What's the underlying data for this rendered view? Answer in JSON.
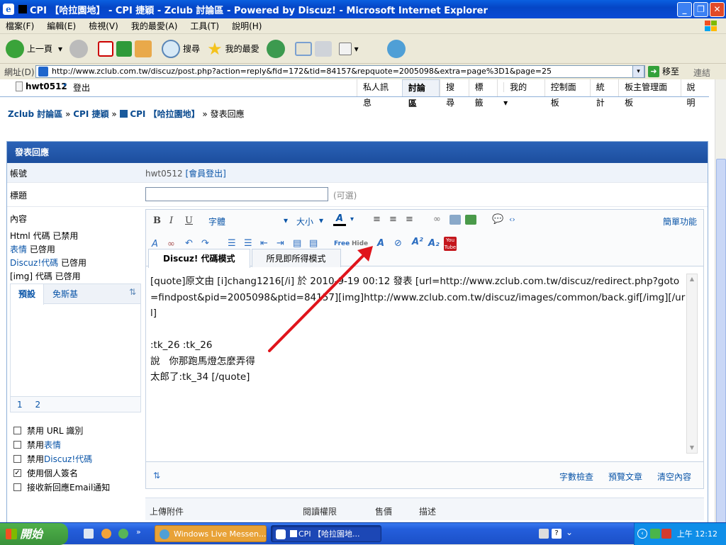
{
  "window": {
    "title": "CPI 【哈拉園地】 - CPI 捷穎 - Zclub 討論區 - Powered by Discuz! - Microsoft Internet Explorer"
  },
  "menu": [
    "檔案(F)",
    "編輯(E)",
    "檢視(V)",
    "我的最愛(A)",
    "工具(T)",
    "說明(H)"
  ],
  "toolbar": {
    "back": "上一頁",
    "search": "搜尋",
    "favorites": "我的最愛"
  },
  "address": {
    "label": "網址(D)",
    "url": "http://www.zclub.com.tw/discuz/post.php?action=reply&fid=172&tid=84157&repquote=2005098&extra=page%3D1&page=25",
    "go": "移至",
    "links": "連結"
  },
  "user": {
    "name": "hwt0512",
    "logout": "登出"
  },
  "topnav": [
    "私人訊息",
    "討論區",
    "搜尋",
    "標籤",
    "我的",
    "控制面板",
    "統計",
    "板主管理面板",
    "說明"
  ],
  "breadcrumb": {
    "home": "Zclub 討論區",
    "sep": "»",
    "forum1": "CPI 捷穎",
    "forum2": "CPI 【哈拉園地】",
    "current": "發表回應"
  },
  "form": {
    "header": "發表回應",
    "account_label": "帳號",
    "account_value": "hwt0512",
    "account_logout": "[會員登出]",
    "title_label": "標題",
    "title_hint": "(可選)",
    "content_label": "內容",
    "status": [
      {
        "name": "Html 代碼",
        "state": "已禁用"
      },
      {
        "name": "表情",
        "state": "已啓用"
      },
      {
        "name": "Discuz!代碼",
        "state": "已啓用"
      },
      {
        "name": "[img] 代碼",
        "state": "已啓用"
      }
    ],
    "smiley_tabs": [
      "預設",
      "免斯基"
    ],
    "smiley_pages": [
      "1",
      "2"
    ],
    "options": [
      {
        "label": "禁用 URL 識別",
        "checked": false
      },
      {
        "label": "禁用 表情",
        "checked": false
      },
      {
        "label": "禁用 Discuz!代碼",
        "checked": false
      },
      {
        "label": "使用個人簽名",
        "checked": true
      },
      {
        "label": "接收新回應Email通知",
        "checked": false
      }
    ]
  },
  "editor": {
    "font_select": "字體",
    "size_select": "大小",
    "simple_mode": "簡單功能",
    "tabs": [
      "Discuz! 代碼模式",
      "所見即所得模式"
    ],
    "text": "[quote]原文由 [i]chang1216[/i] 於 2010-9-19 00:12 發表 [url=http://www.zclub.com.tw/discuz/redirect.php?goto=findpost&pid=2005098&ptid=84157][img]http://www.zclub.com.tw/discuz/images/common/back.gif[/img][/url]\n\n:tk_26 :tk_26\n說   你那跑馬燈怎麼弄得\n太郎了:tk_34 [/quote]",
    "footer": [
      "字數檢查",
      "預覽文章",
      "清空內容"
    ]
  },
  "attach": {
    "cols": [
      "上傳附件",
      "閱讀權限",
      "售價",
      "描述"
    ]
  },
  "taskbar": {
    "start": "開始",
    "tasks": [
      "Windows Live Messen...",
      "CPI 【哈拉園地..."
    ],
    "clock": "上午 12:12"
  },
  "colors": {
    "arrow": "#e0141b",
    "link": "#0a55a8",
    "header": "#1f56a8"
  }
}
